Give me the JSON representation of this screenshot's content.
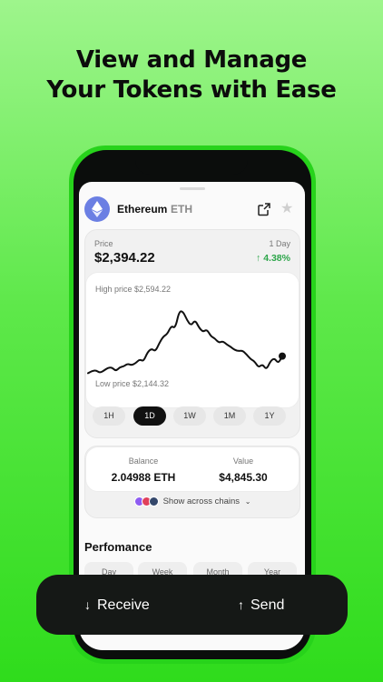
{
  "headline": {
    "line1": "View and Manage",
    "line2": "Your Tokens with Ease"
  },
  "token": {
    "name": "Ethereum",
    "symbol": "ETH",
    "logo_icon": "ethereum-icon",
    "logo_color": "#6b7fe3"
  },
  "header_actions": {
    "share_icon": "share-icon",
    "favorite_icon": "star-icon"
  },
  "price": {
    "label": "Price",
    "value": "$2,394.22",
    "period": "1 Day",
    "change": "↑ 4.38%",
    "change_color": "#2ea64b"
  },
  "chart": {
    "high_label": "High price $2,594.22",
    "low_label": "Low price $2,144.32"
  },
  "chart_data": {
    "type": "line",
    "title": "",
    "xlabel": "",
    "ylabel": "",
    "series": [
      {
        "values": [
          2171,
          2183,
          2186,
          2173,
          2185,
          2199,
          2202,
          2182,
          2202,
          2207,
          2221,
          2213,
          2224,
          2244,
          2233,
          2281,
          2301,
          2285,
          2330,
          2365,
          2377,
          2421,
          2407,
          2498,
          2495,
          2449,
          2421,
          2452,
          2411,
          2388,
          2402,
          2365,
          2354,
          2331,
          2340,
          2322,
          2310,
          2293,
          2288,
          2290,
          2270,
          2245,
          2234,
          2201,
          2219,
          2189,
          2234,
          2251,
          2222,
          2261
        ]
      }
    ],
    "ylim": [
      2144.32,
      2594.22
    ],
    "grid": false
  },
  "ranges": [
    "1H",
    "1D",
    "1W",
    "1M",
    "1Y"
  ],
  "active_range": "1D",
  "balance": {
    "balance_label": "Balance",
    "balance_value": "2.04988 ETH",
    "value_label": "Value",
    "value_value": "$4,845.30",
    "chains_label": "Show across chains"
  },
  "performance": {
    "title": "Perfomance",
    "tabs": [
      "Day",
      "Week",
      "Month",
      "Year"
    ]
  },
  "actions": {
    "receive": "Receive",
    "receive_icon": "arrow-down-icon",
    "send": "Send",
    "send_icon": "arrow-up-icon"
  }
}
